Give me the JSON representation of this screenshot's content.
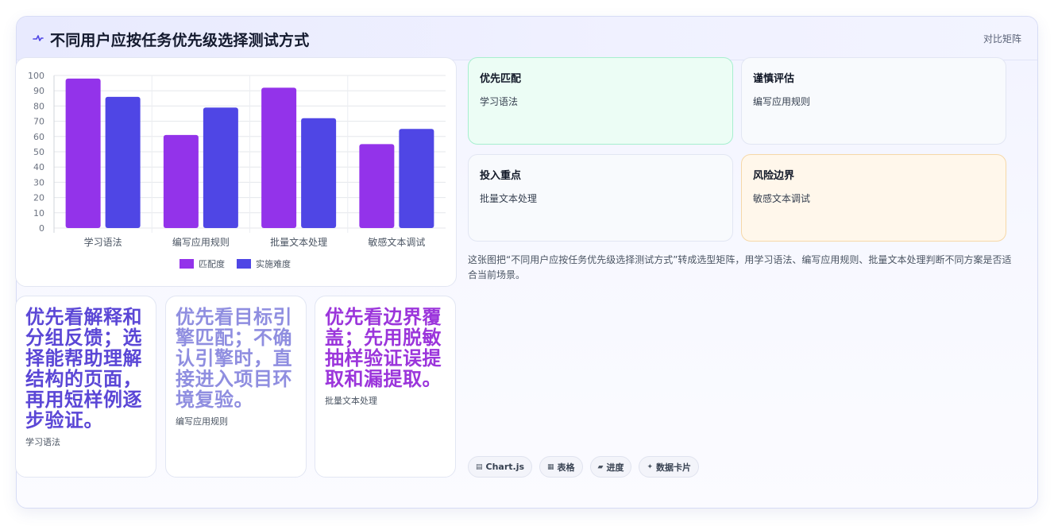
{
  "header": {
    "title": "不同用户应按任务优先级选择测试方式",
    "action": "对比矩阵",
    "icon": "pulse-icon"
  },
  "matrix": [
    {
      "title": "优先匹配",
      "value": "学习语法"
    },
    {
      "title": "谨慎评估",
      "value": "编写应用规则"
    },
    {
      "title": "投入重点",
      "value": "批量文本处理"
    },
    {
      "title": "风险边界",
      "value": "敏感文本调试"
    }
  ],
  "description": "这张图把“不同用户应按任务优先级选择测试方式”转成选型矩阵，用学习语法、编写应用规则、批量文本处理判断不同方案是否适合当前场景。",
  "tips": [
    {
      "text": "优先看解释和分组反馈；选择能帮助理解结构的页面，再用短样例逐步验证。",
      "tag": "学习语法"
    },
    {
      "text": "优先看目标引擎匹配；不确认引擎时，直接进入项目环境复验。",
      "tag": "编写应用规则"
    },
    {
      "text": "优先看边界覆盖；先用脱敏抽样验证误提取和漏提取。",
      "tag": "批量文本处理"
    }
  ],
  "chips": [
    {
      "icon": "chart-icon",
      "glyph": "▤",
      "label": "Chart.js"
    },
    {
      "icon": "table-icon",
      "glyph": "▦",
      "label": "表格"
    },
    {
      "icon": "progress-icon",
      "glyph": "▰",
      "label": "进度"
    },
    {
      "icon": "sparkle-icon",
      "glyph": "✦",
      "label": "数据卡片"
    }
  ],
  "chart_data": {
    "type": "bar",
    "categories": [
      "学习语法",
      "编写应用规则",
      "批量文本处理",
      "敏感文本调试"
    ],
    "series": [
      {
        "name": "匹配度",
        "values": [
          98,
          61,
          92,
          55
        ],
        "color": "#9333ea"
      },
      {
        "name": "实施难度",
        "values": [
          86,
          79,
          72,
          65
        ],
        "color": "#4f46e5"
      }
    ],
    "ylim": [
      0,
      100
    ],
    "yticks": [
      0,
      10,
      20,
      30,
      40,
      50,
      60,
      70,
      80,
      90,
      100
    ],
    "grid": true,
    "legend": "bottom"
  }
}
